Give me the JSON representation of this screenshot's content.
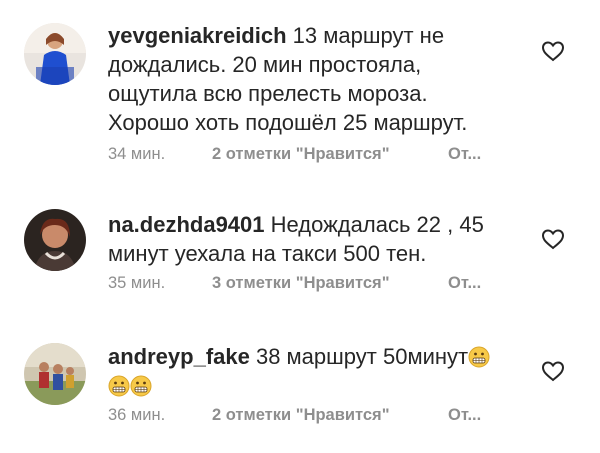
{
  "comments": [
    {
      "username": "yevgeniakreidich",
      "text": " 13 маршрут не дождались. 20 мин простояла, ощутила всю прелесть мороза. Хорошо хоть подошёл 25 маршрут.",
      "time": "34 мин.",
      "likes": "2 отметки \"Нравится\"",
      "reply": "От...",
      "avatar_icon": "user-photo-woman-blue-dress",
      "like_icon": "heart-outline-icon"
    },
    {
      "username": "na.dezhda9401",
      "text": " Недождалась 22 ,  45 минут уехала на такси 500 тен.",
      "time": "35 мин.",
      "likes": "3 отметки \"Нравится\"",
      "reply": "От...",
      "avatar_icon": "user-photo-woman-portrait",
      "like_icon": "heart-outline-icon"
    },
    {
      "username": "andreyp_fake",
      "text": " 38 маршрут 50минут",
      "emojis": [
        "grimacing-face",
        "grimacing-face",
        "grimacing-face"
      ],
      "time": "36 мин.",
      "likes": "2 отметки \"Нравится\"",
      "reply": "От...",
      "avatar_icon": "user-photo-group-outdoor",
      "like_icon": "heart-outline-icon"
    }
  ],
  "colors": {
    "text": "#262626",
    "meta": "#8e8e8e",
    "background": "#ffffff"
  }
}
